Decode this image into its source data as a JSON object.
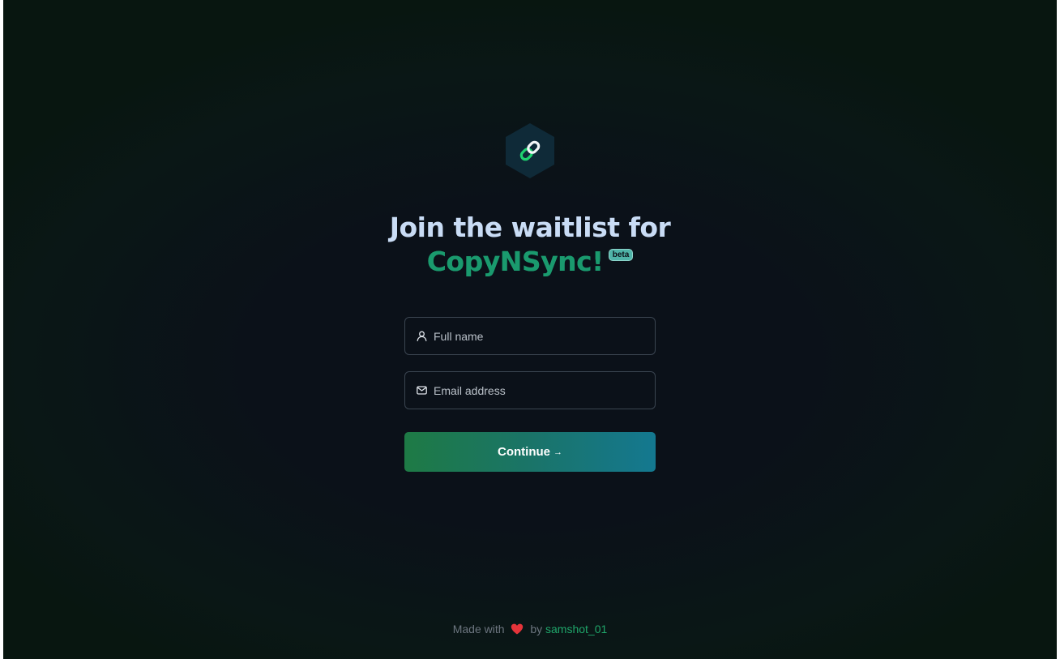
{
  "brand": {
    "logo_icon": "chain-link-icon",
    "accent_green": "#1d9a5a",
    "accent_teal": "#169a86"
  },
  "headline": {
    "line1": "Join the waitlist for",
    "brand_name": "CopyNSync!",
    "badge": "beta"
  },
  "form": {
    "full_name": {
      "icon": "user-icon",
      "placeholder": "Full name",
      "value": ""
    },
    "email": {
      "icon": "mail-icon",
      "placeholder": "Email address",
      "value": ""
    },
    "continue_label": "Continue",
    "continue_arrow": "→"
  },
  "footer": {
    "made_with": "Made with",
    "heart_icon": "heart-icon",
    "by": "by",
    "author": "samshot_01"
  }
}
